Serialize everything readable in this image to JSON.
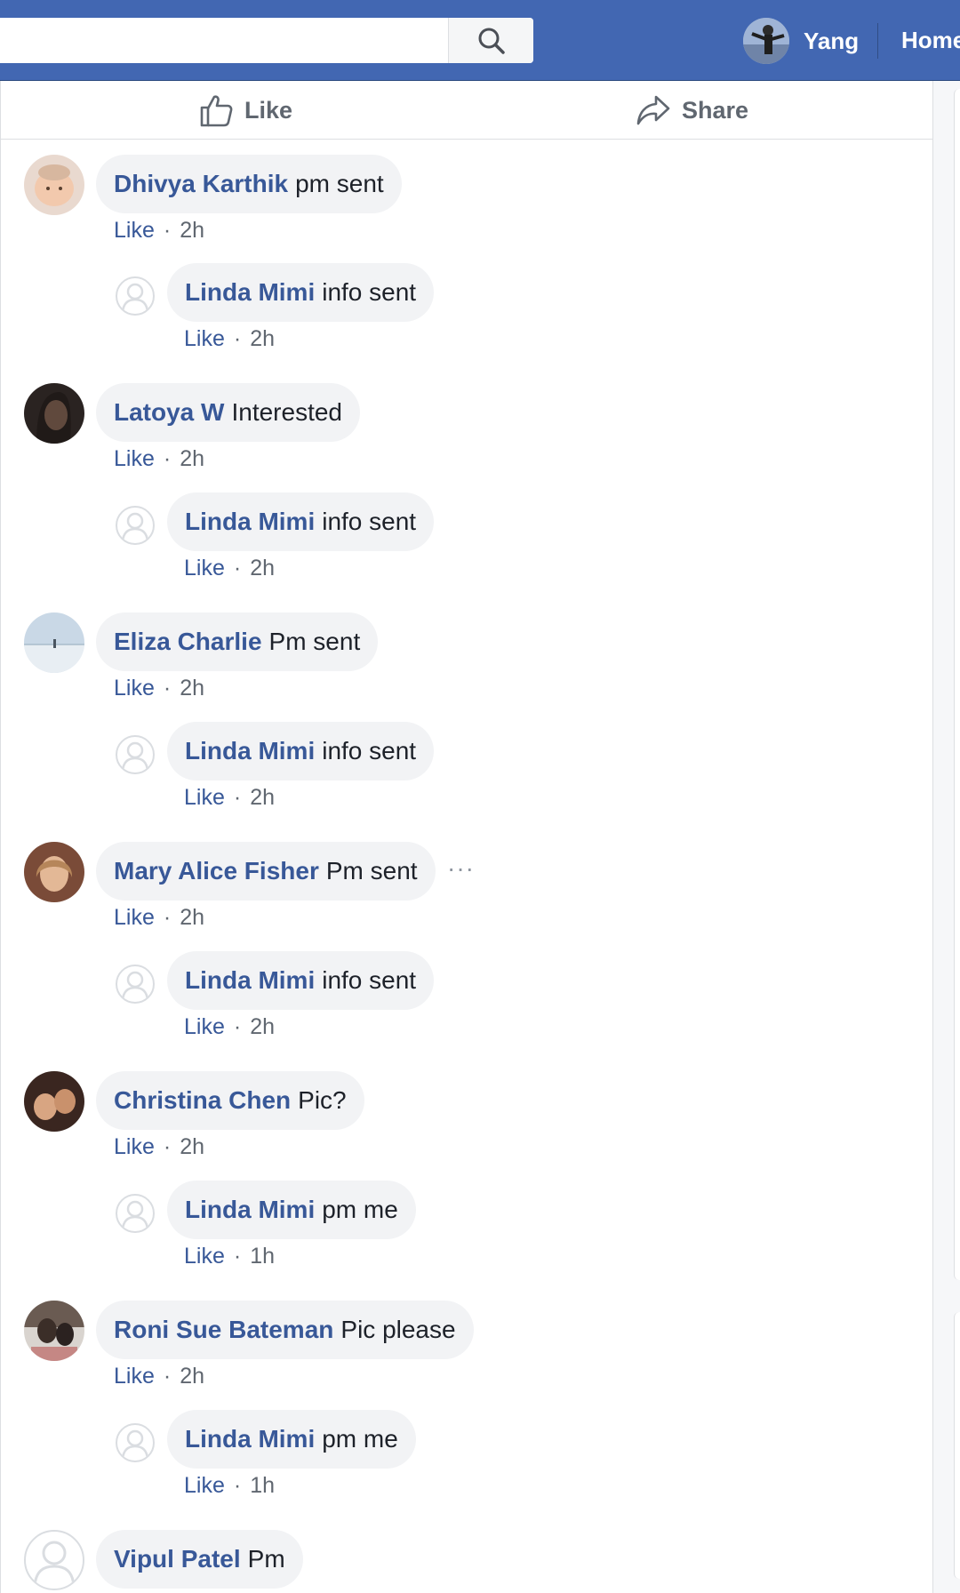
{
  "topbar": {
    "search_placeholder": "",
    "profile_name": "Yang",
    "home_label": "Home",
    "brand_color": "#4267b2"
  },
  "actions": {
    "like_label": "Like",
    "share_label": "Share"
  },
  "comments": [
    {
      "author": "Dhivya Karthik",
      "text": "pm sent",
      "like": "Like",
      "sep": "·",
      "time": "2h"
    },
    {
      "author": "Linda Mimi",
      "text": "info sent",
      "like": "Like",
      "sep": "·",
      "time": "2h"
    },
    {
      "author": "Latoya W",
      "text": "Interested",
      "like": "Like",
      "sep": "·",
      "time": "2h"
    },
    {
      "author": "Linda Mimi",
      "text": "info sent",
      "like": "Like",
      "sep": "·",
      "time": "2h"
    },
    {
      "author": "Eliza Charlie",
      "text": "Pm sent",
      "like": "Like",
      "sep": "·",
      "time": "2h"
    },
    {
      "author": "Linda Mimi",
      "text": "info sent",
      "like": "Like",
      "sep": "·",
      "time": "2h"
    },
    {
      "author": "Mary Alice Fisher",
      "text": "Pm sent",
      "like": "Like",
      "sep": "·",
      "time": "2h",
      "more": "···"
    },
    {
      "author": "Linda Mimi",
      "text": "info sent",
      "like": "Like",
      "sep": "·",
      "time": "2h"
    },
    {
      "author": "Christina Chen",
      "text": "Pic?",
      "like": "Like",
      "sep": "·",
      "time": "2h"
    },
    {
      "author": "Linda Mimi",
      "text": "pm me",
      "like": "Like",
      "sep": "·",
      "time": "1h"
    },
    {
      "author": "Roni Sue Bateman",
      "text": "Pic please",
      "like": "Like",
      "sep": "·",
      "time": "2h"
    },
    {
      "author": "Linda Mimi",
      "text": "pm me",
      "like": "Like",
      "sep": "·",
      "time": "1h"
    },
    {
      "author": "Vipul Patel",
      "text": "Pm"
    }
  ]
}
